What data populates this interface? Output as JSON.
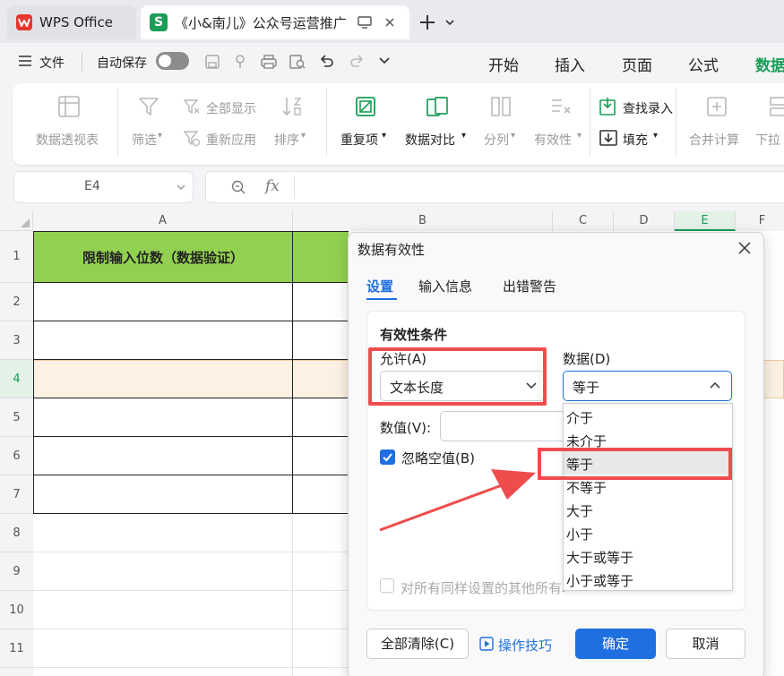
{
  "titlebar": {
    "app_tab": "WPS Office",
    "doc_badge": "S",
    "doc_tab": "《小&南儿》公众号运营推广"
  },
  "menubar": {
    "file": "文件",
    "autosave": "自动保存",
    "tabs": [
      "开始",
      "插入",
      "页面",
      "公式",
      "数据"
    ]
  },
  "ribbon": {
    "pivot": "数据透视表",
    "show_all": "全部显示",
    "filter": "筛选",
    "reapply": "重新应用",
    "sort": "排序",
    "duplicates": "重复项",
    "compare": "数据对比",
    "split": "分列",
    "validity": "有效性",
    "lookup_entry": "查找录入",
    "fill": "填充",
    "consolidate": "合并计算",
    "dropdown_list": "下拉"
  },
  "formula_bar": {
    "name_box": "E4",
    "fx": "fx"
  },
  "sheet": {
    "columns": [
      "A",
      "B",
      "C",
      "D",
      "E",
      "F"
    ],
    "rows": [
      "1",
      "2",
      "3",
      "4",
      "5",
      "6",
      "7",
      "8",
      "9",
      "10",
      "11"
    ],
    "a1": "限制输入位数（数据验证）",
    "colors": {
      "header_fill": "#92d050",
      "selected_row": "#fdf1e4"
    }
  },
  "dialog": {
    "title": "数据有效性",
    "tabs": [
      "设置",
      "输入信息",
      "出错警告"
    ],
    "section": "有效性条件",
    "allow_label": "允许(A)",
    "allow_value": "文本长度",
    "data_label": "数据(D)",
    "data_value": "等于",
    "value_label": "数值(V):",
    "ignore_blank": "忽略空值(B)",
    "apply_all": "对所有同样设置的其他所有单元格应用这些更改",
    "options": [
      "介于",
      "未介于",
      "等于",
      "不等于",
      "大于",
      "小于",
      "大于或等于",
      "小于或等于"
    ],
    "buttons": {
      "clear": "全部清除(C)",
      "tips": "操作技巧",
      "ok": "确定",
      "cancel": "取消"
    },
    "colors": {
      "accent": "#1f6fe0",
      "highlight": "#ef4d4d"
    }
  }
}
